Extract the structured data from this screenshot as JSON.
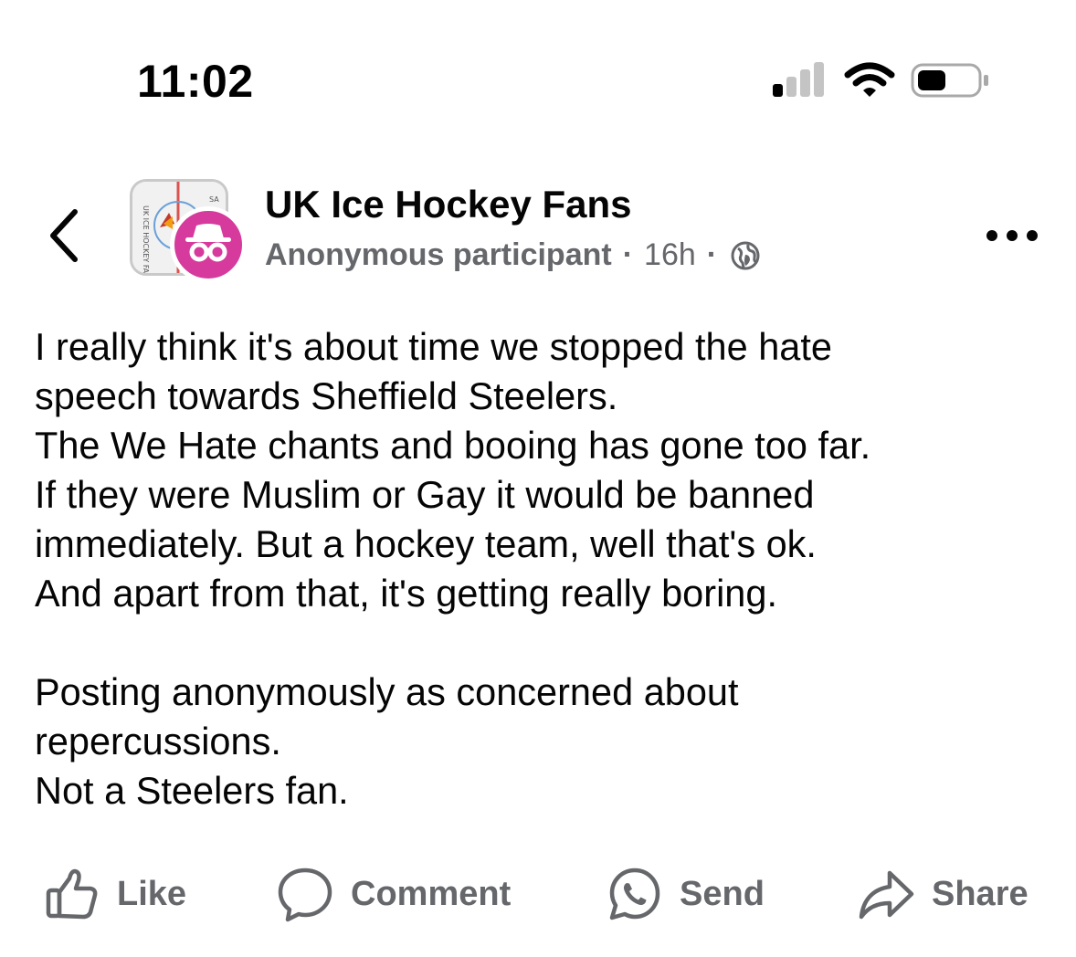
{
  "status_bar": {
    "time": "11:02",
    "icons": [
      "cellular-signal-icon",
      "wifi-icon",
      "battery-icon"
    ]
  },
  "header": {
    "group_name": "UK Ice Hockey Fans",
    "author": "Anonymous participant",
    "separator": "·",
    "timestamp": "16h",
    "audience_icon": "globe-icon",
    "avatar_badge_icon": "incognito-icon",
    "badge_color": "#d63a9c"
  },
  "post": {
    "paragraphs": [
      "I really think it's about time we stopped the hate\nspeech towards Sheffield Steelers.\nThe We Hate chants and booing has gone too far.\nIf they were Muslim or Gay it would be banned\nimmediately. But a hockey team, well that's ok.\nAnd apart from that, it's getting really boring.",
      "Posting anonymously as concerned about\nrepercussions.\nNot a Steelers fan."
    ]
  },
  "actions": {
    "like": "Like",
    "comment": "Comment",
    "send": "Send",
    "share": "Share"
  },
  "colors": {
    "text_primary": "#050505",
    "text_secondary": "#65676b"
  }
}
